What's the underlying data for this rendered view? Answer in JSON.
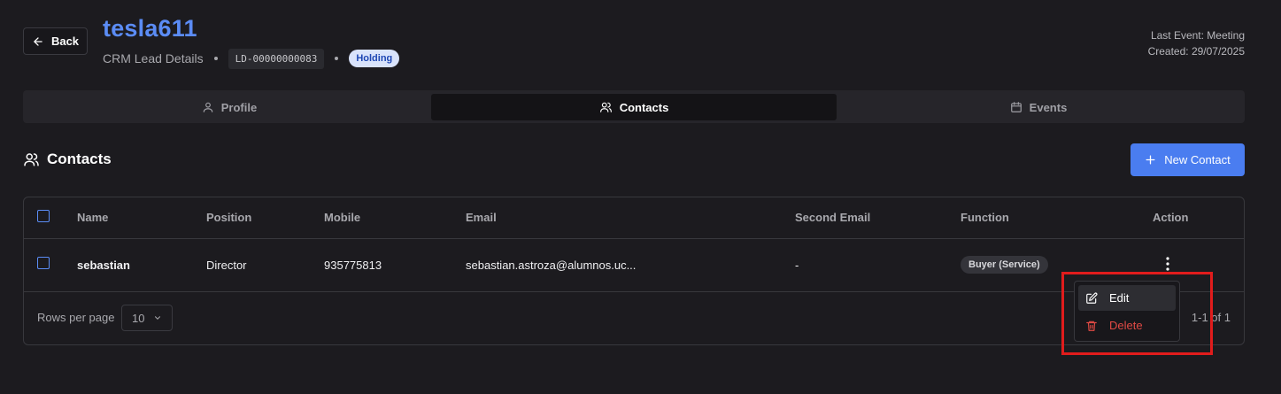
{
  "header": {
    "back_label": "Back",
    "title": "tesla611",
    "subtitle": "CRM Lead Details",
    "lead_code": "LD-00000000083",
    "status_badge": "Holding",
    "last_event": "Last Event: Meeting",
    "created": "Created: 29/07/2025"
  },
  "tabs": [
    {
      "label": "Profile",
      "icon": "user-icon",
      "active": false
    },
    {
      "label": "Contacts",
      "icon": "users-icon",
      "active": true
    },
    {
      "label": "Events",
      "icon": "calendar-icon",
      "active": false
    }
  ],
  "section": {
    "title": "Contacts",
    "new_button": "New Contact"
  },
  "table": {
    "columns": [
      "Name",
      "Position",
      "Mobile",
      "Email",
      "Second Email",
      "Function",
      "Action"
    ],
    "rows": [
      {
        "name": "sebastian",
        "position": "Director",
        "mobile": "935775813",
        "email": "sebastian.astroza@alumnos.uc...",
        "second_email": "-",
        "function": "Buyer (Service)"
      }
    ],
    "rows_per_page_label": "Rows per page",
    "rows_per_page_value": "10",
    "pagination": "1-1 of 1"
  },
  "action_menu": {
    "edit": "Edit",
    "delete": "Delete"
  },
  "colors": {
    "accent": "#4a7df0",
    "title": "#5b8cf5",
    "danger": "#e04a44",
    "highlight": "#e11c1c"
  }
}
